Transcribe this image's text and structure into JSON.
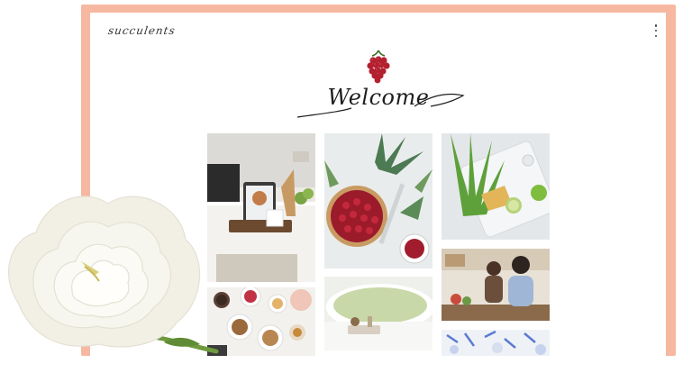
{
  "site": {
    "logo": "succulents",
    "heading": "Welcome",
    "menu_icon": "more-vertical-icon",
    "berries_icon": "berries-illustration"
  },
  "gallery": {
    "tiles": [
      {
        "name": "kitchen-tablet-photo"
      },
      {
        "name": "berry-tart-photo"
      },
      {
        "name": "herbs-tray-photo"
      },
      {
        "name": "women-cooking-photo"
      },
      {
        "name": "breakfast-table-photo"
      },
      {
        "name": "bath-tub-photo"
      },
      {
        "name": "blue-tableware-photo"
      }
    ]
  },
  "decor": {
    "flower": "white-rose-illustration"
  },
  "colors": {
    "frame": "#f6b8a0",
    "accent": "#b3202f"
  }
}
